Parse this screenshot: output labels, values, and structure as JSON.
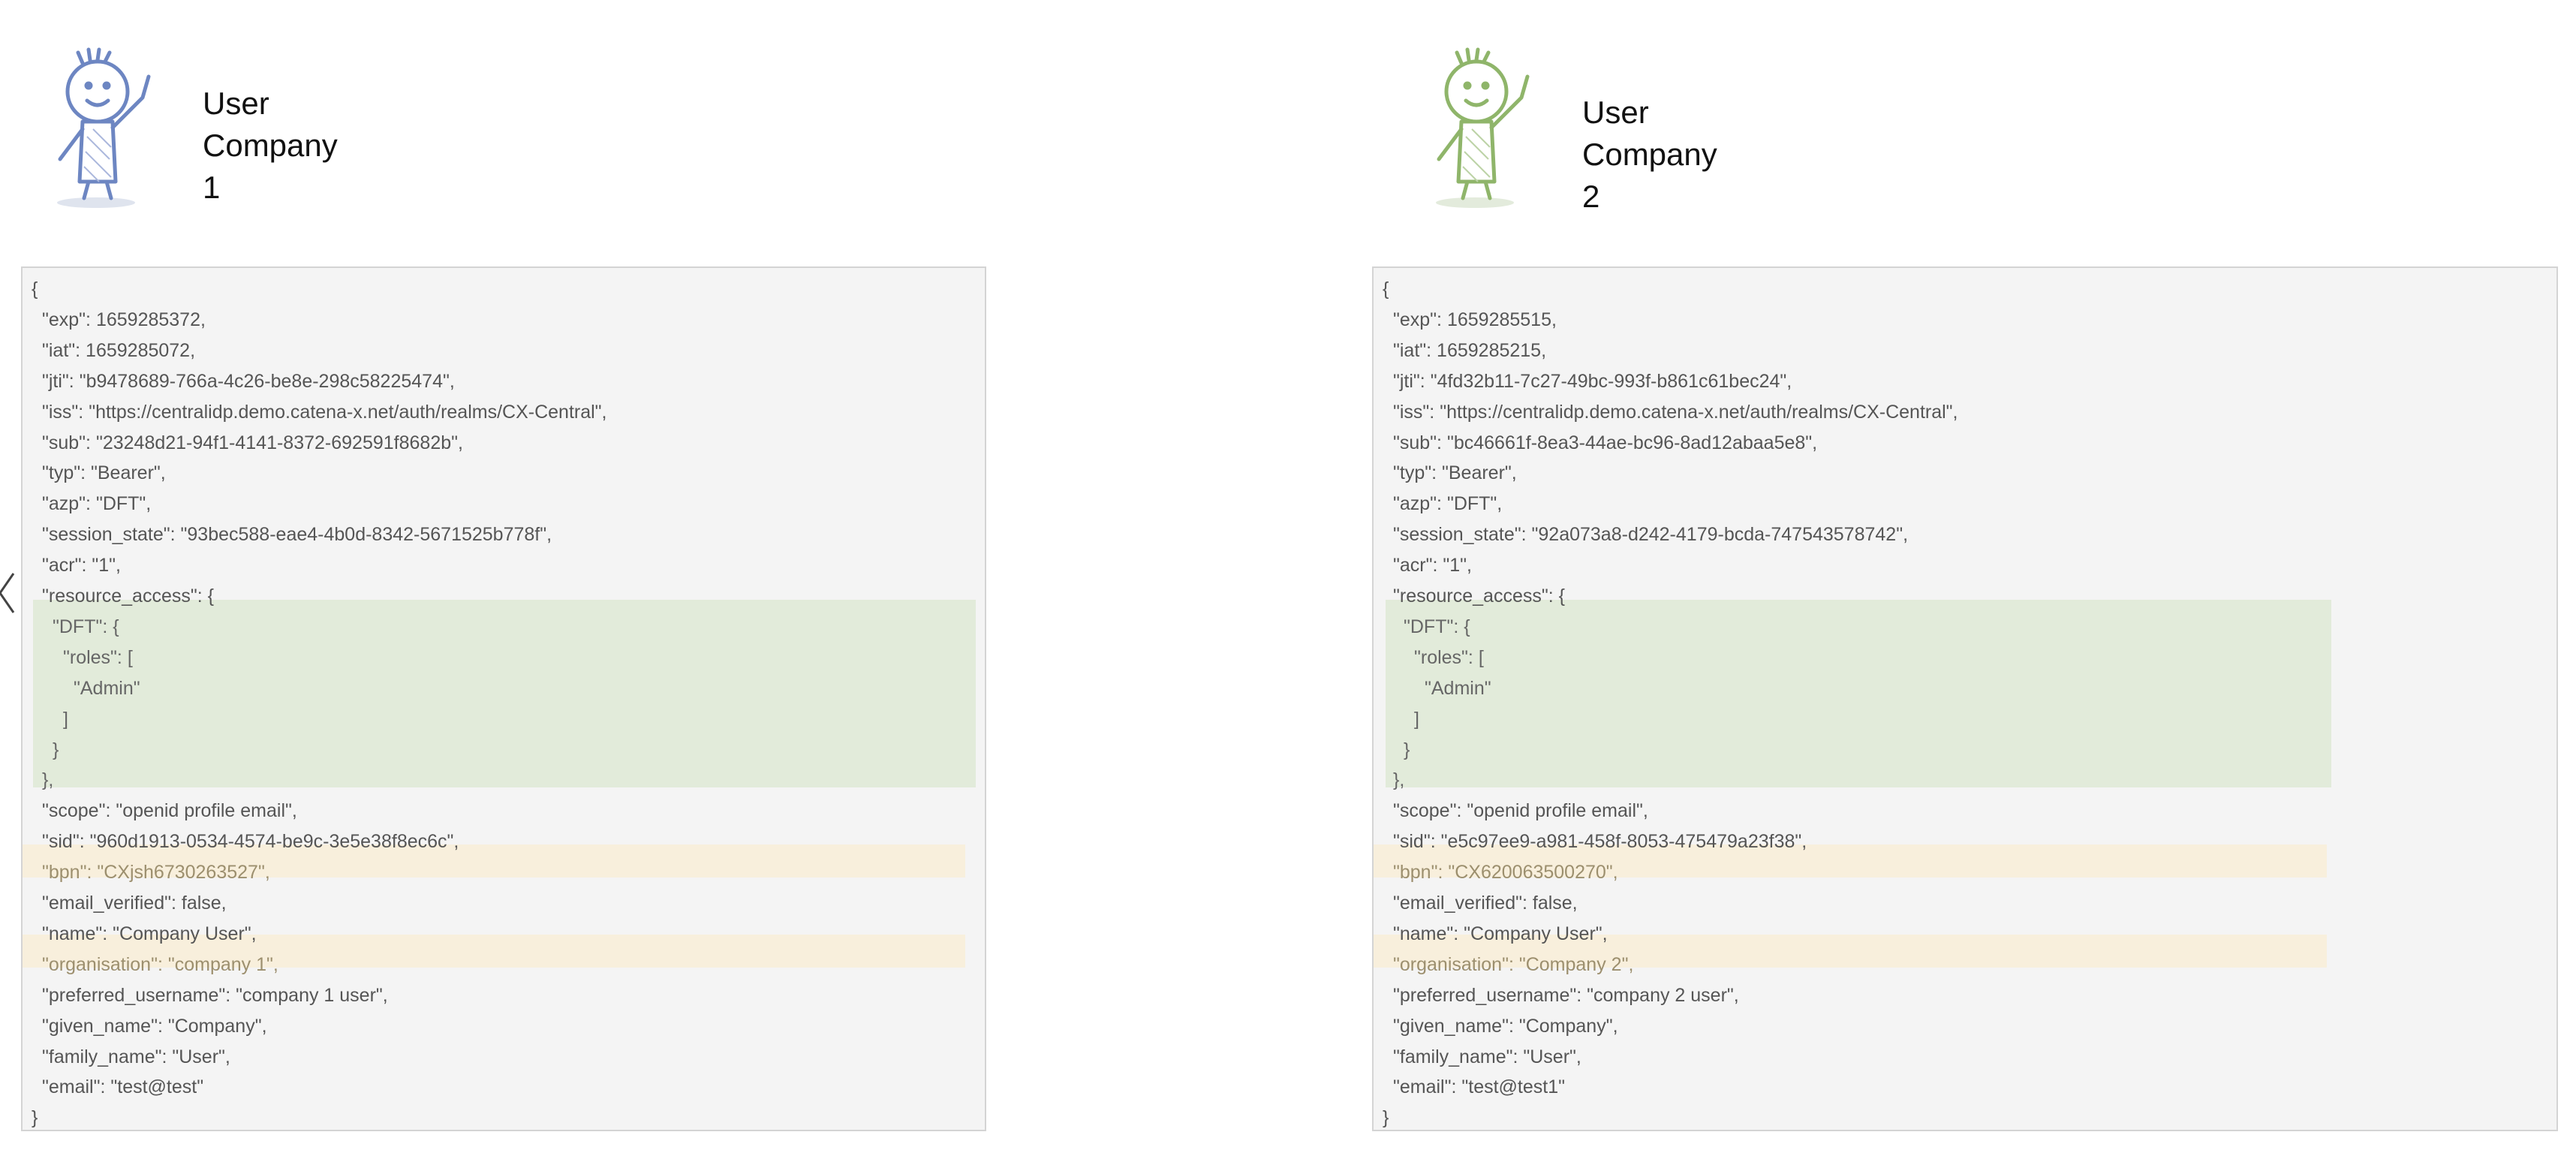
{
  "users": [
    {
      "line1": "User",
      "line2": "Company 1",
      "avatar_icon": "stick-figure-waving-icon",
      "avatar_color": "#6d86c2"
    },
    {
      "line1": "User",
      "line2": "Company 2",
      "avatar_icon": "stick-figure-waving-icon",
      "avatar_color": "#8fb56a"
    }
  ],
  "tokens": [
    {
      "lines": [
        "{",
        "\"exp\": 1659285372,",
        "\"iat\": 1659285072,",
        "\"jti\": \"b9478689-766a-4c26-be8e-298c58225474\",",
        "\"iss\": \"https://centralidp.demo.catena-x.net/auth/realms/CX-Central\",",
        "\"sub\": \"23248d21-94f1-4141-8372-692591f8682b\",",
        "\"typ\": \"Bearer\",",
        "\"azp\": \"DFT\",",
        "\"session_state\": \"93bec588-eae4-4b0d-8342-5671525b778f\",",
        "\"acr\": \"1\",",
        "\"resource_access\": {",
        "\"DFT\": {",
        "\"roles\": [",
        "\"Admin\"",
        "]",
        "}",
        "},",
        "\"scope\": \"openid profile email\",",
        "\"sid\": \"960d1913-0534-4574-be9c-3e5e38f8ec6c\",",
        "\"bpn\": \"CXjsh6730263527\",",
        "\"email_verified\": false,",
        "\"name\": \"Company User\",",
        "\"organisation\": \"company 1\",",
        "\"preferred_username\": \"company 1 user\",",
        "\"given_name\": \"Company\",",
        "\"family_name\": \"User\",",
        "\"email\": \"test@test\"",
        "}"
      ]
    },
    {
      "lines": [
        "{",
        "\"exp\": 1659285515,",
        "\"iat\": 1659285215,",
        "\"jti\": \"4fd32b11-7c27-49bc-993f-b861c61bec24\",",
        "\"iss\": \"https://centralidp.demo.catena-x.net/auth/realms/CX-Central\",",
        "\"sub\": \"bc46661f-8ea3-44ae-bc96-8ad12abaa5e8\",",
        "\"typ\": \"Bearer\",",
        "\"azp\": \"DFT\",",
        "\"session_state\": \"92a073a8-d242-4179-bcda-747543578742\",",
        "\"acr\": \"1\",",
        "\"resource_access\": {",
        "\"DFT\": {",
        "\"roles\": [",
        "\"Admin\"",
        "]",
        "}",
        "},",
        "\"scope\": \"openid profile email\",",
        "\"sid\": \"e5c97ee9-a981-458f-8053-475479a23f38\",",
        "\"bpn\": \"CX620063500270\",",
        "\"email_verified\": false,",
        "\"name\": \"Company User\",",
        "\"organisation\": \"Company 2\",",
        "\"preferred_username\": \"company 2 user\",",
        "\"given_name\": \"Company\",",
        "\"family_name\": \"User\",",
        "\"email\": \"test@test1\"",
        "}"
      ]
    }
  ],
  "colors": {
    "roles_highlight": "#e2ebda",
    "identity_highlight": "#f8efdc",
    "panel_background": "#f4f4f4"
  }
}
